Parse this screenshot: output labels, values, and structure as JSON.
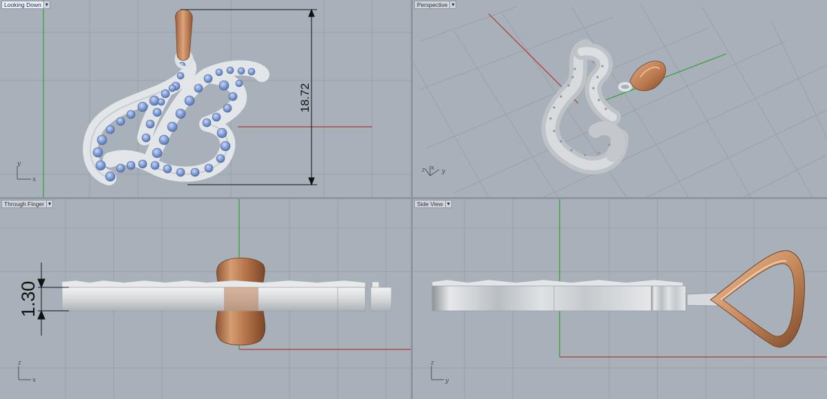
{
  "viewports": {
    "top_left": {
      "label": "Looking Down",
      "axis_h": "x",
      "axis_v": "y",
      "dimension": "18.72"
    },
    "top_right": {
      "label": "Perspective",
      "axis_a": "z",
      "axis_b": "x",
      "axis_c": "y"
    },
    "bottom_left": {
      "label": "Through Finger",
      "axis_h": "x",
      "axis_v": "z",
      "dimension": "1.30"
    },
    "bottom_right": {
      "label": "Side View",
      "axis_h": "y",
      "axis_v": "z"
    }
  },
  "icons": {
    "dropdown": "chevron-down-icon"
  },
  "colors": {
    "viewport_bg": "#a8b0b9",
    "grid_line": "#98a1aa",
    "x_axis": "#b13636",
    "y_axis": "#2fa030",
    "metal_white": "#e3e6e9",
    "rose_gold": "#c98b5e",
    "gem_blue": "#7d9bd6"
  }
}
